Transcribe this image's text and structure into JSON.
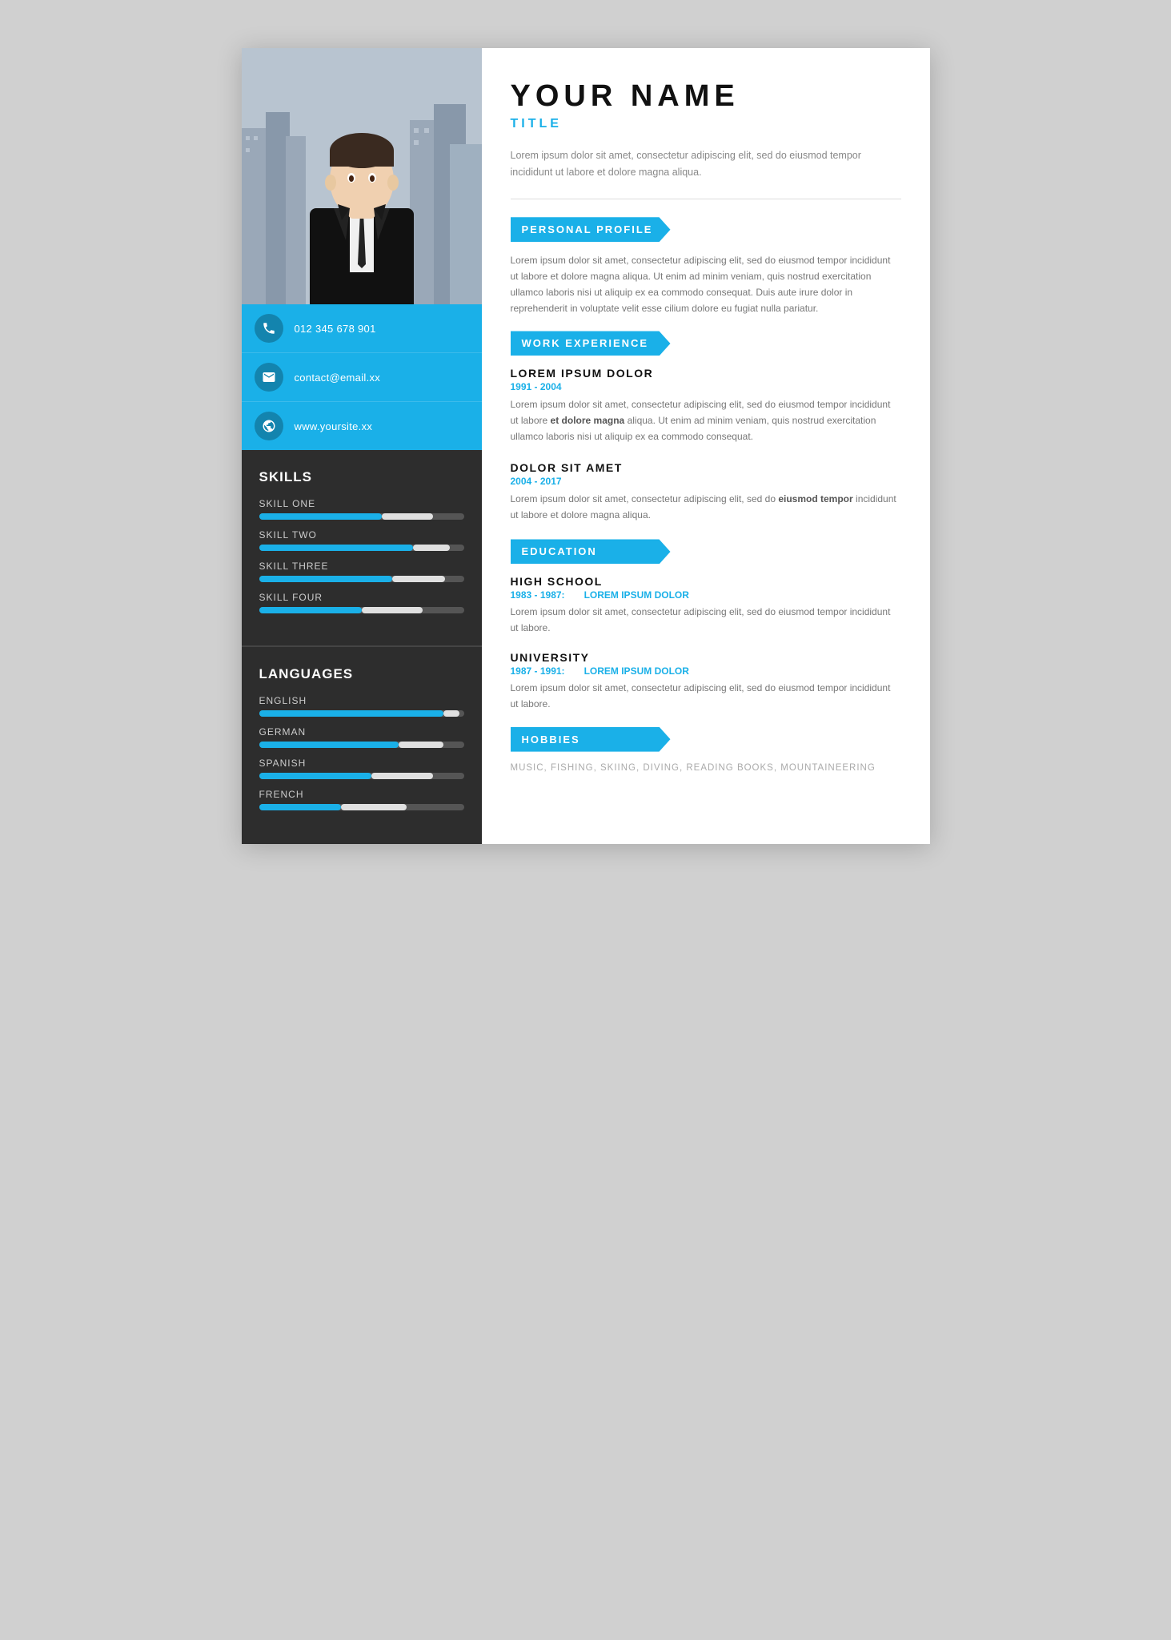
{
  "header": {
    "name": "YOUR NAME",
    "title": "TITLE"
  },
  "intro": "Lorem ipsum dolor sit amet, consectetur adipiscing elit, sed do eiusmod tempor incididunt ut labore et dolore magna aliqua.",
  "contact": {
    "phone": "012 345 678 901",
    "email": "contact@email.xx",
    "website": "www.yoursite.xx"
  },
  "skills": {
    "heading": "SKILLS",
    "items": [
      {
        "label": "SKILL ONE",
        "fill": 60,
        "white_start": 60,
        "white_width": 25
      },
      {
        "label": "SKILL TWO",
        "fill": 75,
        "white_start": 75,
        "white_width": 20
      },
      {
        "label": "SKILL THREE",
        "fill": 65,
        "white_start": 65,
        "white_width": 28
      },
      {
        "label": "SKILL FOUR",
        "fill": 50,
        "white_start": 50,
        "white_width": 30
      }
    ]
  },
  "languages": {
    "heading": "LANGUAGES",
    "items": [
      {
        "label": "ENGLISH",
        "fill": 90,
        "white_start": 90,
        "white_width": 8
      },
      {
        "label": "GERMAN",
        "fill": 68,
        "white_start": 68,
        "white_width": 22
      },
      {
        "label": "SPANISH",
        "fill": 55,
        "white_start": 55,
        "white_width": 30
      },
      {
        "label": "FRENCH",
        "fill": 40,
        "white_start": 40,
        "white_width": 32
      }
    ]
  },
  "sections": {
    "personal_profile": {
      "heading": "PERSONAL PROFILE",
      "text": "Lorem ipsum dolor sit amet, consectetur adipiscing elit, sed do eiusmod tempor incididunt ut labore et dolore magna aliqua. Ut enim ad minim veniam, quis nostrud exercitation ullamco laboris nisi ut aliquip ex ea commodo consequat. Duis aute irure dolor in reprehenderit in voluptate velit esse cilium dolore eu fugiat nulla pariatur."
    },
    "work_experience": {
      "heading": "WORK EXPERIENCE",
      "entries": [
        {
          "title": "LOREM IPSUM DOLOR",
          "years": "1991 - 2004",
          "desc": "Lorem ipsum dolor sit amet, consectetur adipiscing elit, sed do eiusmod tempor incididunt ut labore et dolore magna aliqua. Ut enim ad minim veniam, quis nostrud exercitation ullamco laboris nisi ut aliquip ex ea commodo consequat.",
          "bold_part": "et dolore magna"
        },
        {
          "title": "DOLOR SIT AMET",
          "years": "2004 - 2017",
          "desc": "Lorem ipsum dolor sit amet, consectetur adipiscing elit, sed do eiusmod tempor incididunt ut labore et dolore magna aliqua.",
          "bold_part": "eiusmod tempor"
        }
      ]
    },
    "education": {
      "heading": "EDUCATION",
      "entries": [
        {
          "title": "HIGH SCHOOL",
          "years": "1983 - 1987:",
          "place": "LOREM IPSUM DOLOR",
          "desc": "Lorem ipsum dolor sit amet, consectetur adipiscing elit, sed do eiusmod tempor incididunt ut labore."
        },
        {
          "title": "UNIVERSITY",
          "years": "1987 - 1991:",
          "place": "LOREM IPSUM DOLOR",
          "desc": "Lorem ipsum dolor sit amet, consectetur adipiscing elit, sed do eiusmod tempor incididunt ut labore."
        }
      ]
    },
    "hobbies": {
      "heading": "HOBBIES",
      "list": "MUSIC, FISHING, SKIING, DIVING, READING BOOKS, MOUNTAINEERING"
    }
  }
}
